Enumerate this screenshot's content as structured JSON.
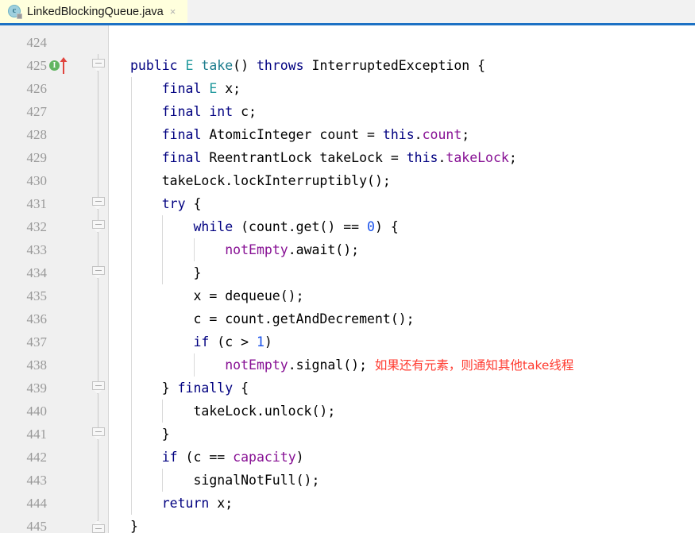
{
  "tab": {
    "label": "LinkedBlockingQueue.java",
    "icon": "java-class-icon",
    "icon_letter": "c",
    "close_label": "×",
    "active": true,
    "background": "#ffffdd",
    "underline_color": "#1d71c4"
  },
  "editor": {
    "gutter_background": "#f0f0f0",
    "background": "#ffffff",
    "line_height": 29,
    "first_line": 424,
    "last_line": 445,
    "colors": {
      "keyword": "#000080",
      "type": "#20999d",
      "method": "#1a7b8c",
      "field": "#871094",
      "number": "#1750eb",
      "comment_annotation": "#ff3b30",
      "line_number": "#999999"
    },
    "gutter_markers": {
      "line": 425,
      "implements_marker": "I",
      "implements_color": "#62b562",
      "override_arrow_color": "#e0443e"
    },
    "fold_markers": [
      425,
      431,
      432,
      434,
      439,
      441,
      445
    ],
    "lines": [
      {
        "n": 424,
        "indent": 0,
        "tokens": []
      },
      {
        "n": 425,
        "indent": 0,
        "tokens": [
          {
            "t": "public",
            "c": "kw"
          },
          {
            "t": " ",
            "c": "plain"
          },
          {
            "t": "E",
            "c": "typ"
          },
          {
            "t": " ",
            "c": "plain"
          },
          {
            "t": "take",
            "c": "mth"
          },
          {
            "t": "() ",
            "c": "plain"
          },
          {
            "t": "throws",
            "c": "kw"
          },
          {
            "t": " InterruptedException {",
            "c": "plain"
          }
        ]
      },
      {
        "n": 426,
        "indent": 1,
        "tokens": [
          {
            "t": "    ",
            "c": "plain"
          },
          {
            "t": "final",
            "c": "kw"
          },
          {
            "t": " ",
            "c": "plain"
          },
          {
            "t": "E",
            "c": "typ"
          },
          {
            "t": " x;",
            "c": "plain"
          }
        ]
      },
      {
        "n": 427,
        "indent": 1,
        "tokens": [
          {
            "t": "    ",
            "c": "plain"
          },
          {
            "t": "final",
            "c": "kw"
          },
          {
            "t": " ",
            "c": "plain"
          },
          {
            "t": "int",
            "c": "kw"
          },
          {
            "t": " c;",
            "c": "plain"
          }
        ]
      },
      {
        "n": 428,
        "indent": 1,
        "tokens": [
          {
            "t": "    ",
            "c": "plain"
          },
          {
            "t": "final",
            "c": "kw"
          },
          {
            "t": " AtomicInteger count = ",
            "c": "plain"
          },
          {
            "t": "this",
            "c": "kw"
          },
          {
            "t": ".",
            "c": "plain"
          },
          {
            "t": "count",
            "c": "fld"
          },
          {
            "t": ";",
            "c": "plain"
          }
        ]
      },
      {
        "n": 429,
        "indent": 1,
        "tokens": [
          {
            "t": "    ",
            "c": "plain"
          },
          {
            "t": "final",
            "c": "kw"
          },
          {
            "t": " ReentrantLock takeLock = ",
            "c": "plain"
          },
          {
            "t": "this",
            "c": "kw"
          },
          {
            "t": ".",
            "c": "plain"
          },
          {
            "t": "takeLock",
            "c": "fld"
          },
          {
            "t": ";",
            "c": "plain"
          }
        ]
      },
      {
        "n": 430,
        "indent": 1,
        "tokens": [
          {
            "t": "    takeLock.lockInterruptibly();",
            "c": "plain"
          }
        ]
      },
      {
        "n": 431,
        "indent": 1,
        "tokens": [
          {
            "t": "    ",
            "c": "plain"
          },
          {
            "t": "try",
            "c": "kw"
          },
          {
            "t": " {",
            "c": "plain"
          }
        ]
      },
      {
        "n": 432,
        "indent": 2,
        "tokens": [
          {
            "t": "        ",
            "c": "plain"
          },
          {
            "t": "while",
            "c": "kw"
          },
          {
            "t": " (count.get() == ",
            "c": "plain"
          },
          {
            "t": "0",
            "c": "num"
          },
          {
            "t": ") {",
            "c": "plain"
          }
        ]
      },
      {
        "n": 433,
        "indent": 3,
        "tokens": [
          {
            "t": "            ",
            "c": "plain"
          },
          {
            "t": "notEmpty",
            "c": "fld"
          },
          {
            "t": ".await();",
            "c": "plain"
          }
        ]
      },
      {
        "n": 434,
        "indent": 2,
        "tokens": [
          {
            "t": "        }",
            "c": "plain"
          }
        ]
      },
      {
        "n": 435,
        "indent": 2,
        "tokens": [
          {
            "t": "        x = dequeue();",
            "c": "plain"
          }
        ]
      },
      {
        "n": 436,
        "indent": 2,
        "tokens": [
          {
            "t": "        c = count.getAndDecrement();",
            "c": "plain"
          }
        ]
      },
      {
        "n": 437,
        "indent": 2,
        "tokens": [
          {
            "t": "        ",
            "c": "plain"
          },
          {
            "t": "if",
            "c": "kw"
          },
          {
            "t": " (c > ",
            "c": "plain"
          },
          {
            "t": "1",
            "c": "num"
          },
          {
            "t": ")",
            "c": "plain"
          }
        ]
      },
      {
        "n": 438,
        "indent": 3,
        "tokens": [
          {
            "t": "            ",
            "c": "plain"
          },
          {
            "t": "notEmpty",
            "c": "fld"
          },
          {
            "t": ".signal();",
            "c": "plain"
          },
          {
            "t": "  如果还有元素，则通知其他take线程",
            "c": "cmt zh"
          }
        ]
      },
      {
        "n": 439,
        "indent": 1,
        "tokens": [
          {
            "t": "    } ",
            "c": "plain"
          },
          {
            "t": "finally",
            "c": "kw"
          },
          {
            "t": " {",
            "c": "plain"
          }
        ]
      },
      {
        "n": 440,
        "indent": 2,
        "tokens": [
          {
            "t": "        takeLock.unlock();",
            "c": "plain"
          }
        ]
      },
      {
        "n": 441,
        "indent": 1,
        "tokens": [
          {
            "t": "    }",
            "c": "plain"
          }
        ]
      },
      {
        "n": 442,
        "indent": 1,
        "tokens": [
          {
            "t": "    ",
            "c": "plain"
          },
          {
            "t": "if",
            "c": "kw"
          },
          {
            "t": " (c == ",
            "c": "plain"
          },
          {
            "t": "capacity",
            "c": "fld"
          },
          {
            "t": ")",
            "c": "plain"
          }
        ]
      },
      {
        "n": 443,
        "indent": 2,
        "tokens": [
          {
            "t": "        signalNotFull();",
            "c": "plain"
          }
        ]
      },
      {
        "n": 444,
        "indent": 1,
        "tokens": [
          {
            "t": "    ",
            "c": "plain"
          },
          {
            "t": "return",
            "c": "kw"
          },
          {
            "t": " x;",
            "c": "plain"
          }
        ]
      },
      {
        "n": 445,
        "indent": 0,
        "tokens": [
          {
            "t": "}",
            "c": "plain"
          }
        ]
      }
    ],
    "indent_guides": [
      {
        "indent": 1,
        "from": 426,
        "to": 444
      },
      {
        "indent": 2,
        "from": 432,
        "to": 434
      },
      {
        "indent": 2,
        "from": 440,
        "to": 440
      },
      {
        "indent": 2,
        "from": 443,
        "to": 443
      },
      {
        "indent": 3,
        "from": 433,
        "to": 433
      },
      {
        "indent": 3,
        "from": 438,
        "to": 438
      }
    ]
  }
}
